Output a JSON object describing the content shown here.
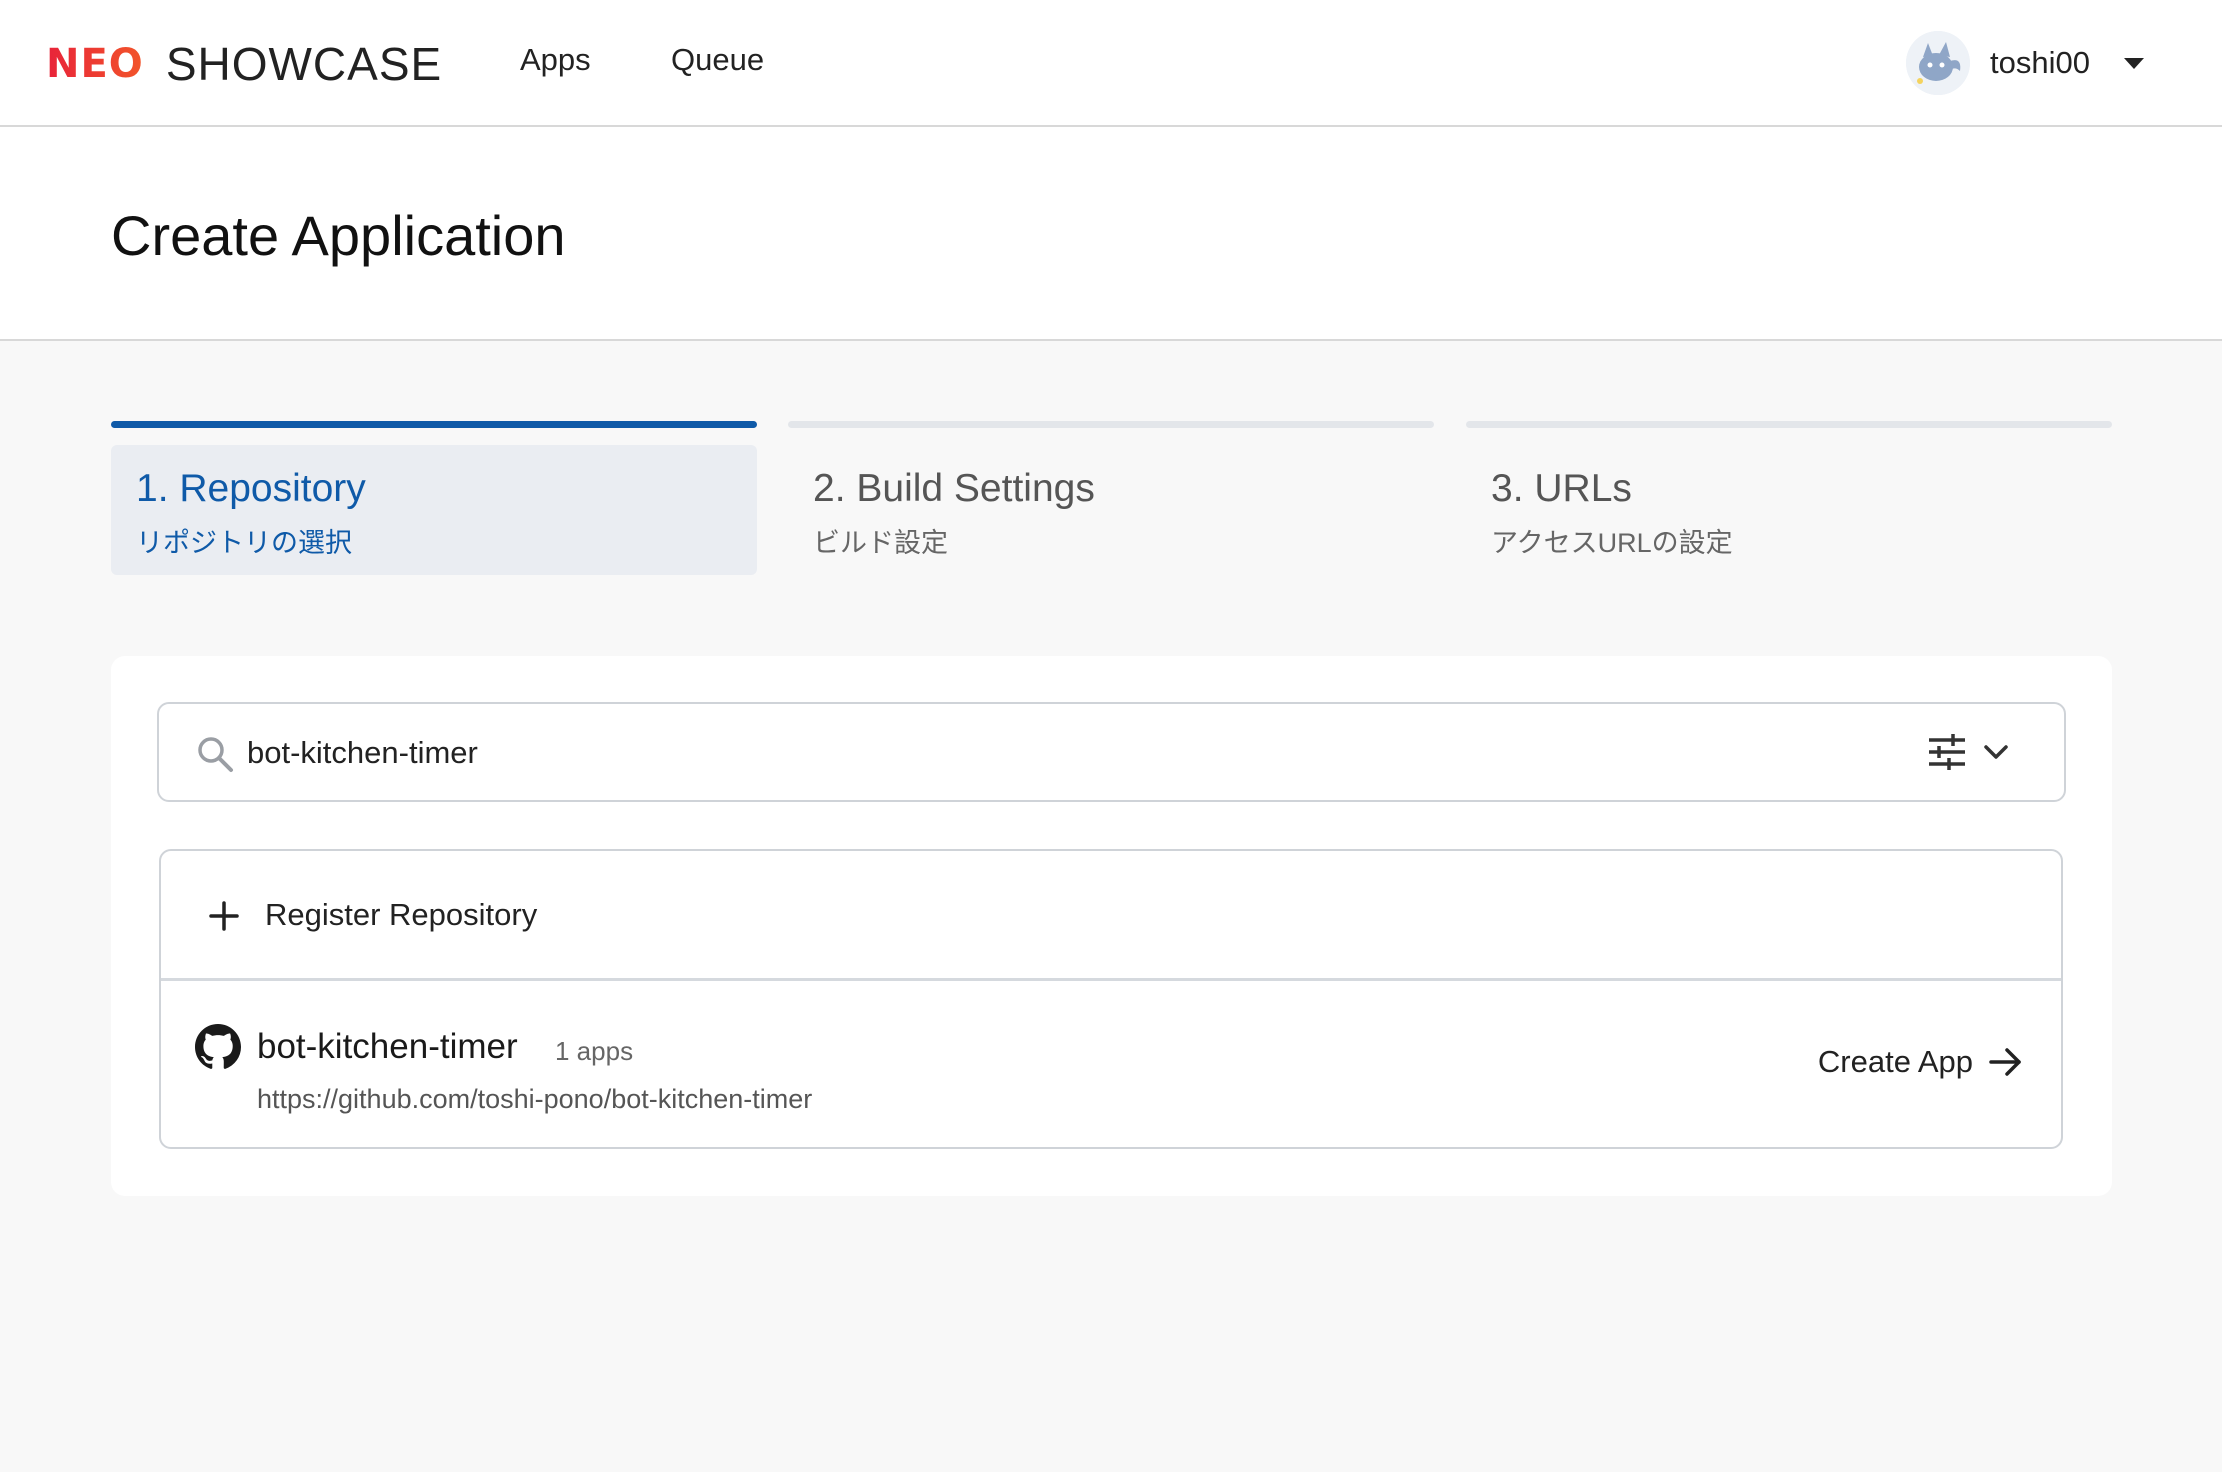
{
  "header": {
    "logo_primary": "NEO",
    "logo_secondary": "SHOWCASE",
    "nav": [
      {
        "label": "Apps"
      },
      {
        "label": "Queue"
      }
    ],
    "user": {
      "name": "toshi00"
    }
  },
  "page": {
    "title": "Create Application"
  },
  "steps": [
    {
      "title": "1. Repository",
      "subtitle": "リポジトリの選択",
      "active": true
    },
    {
      "title": "2. Build Settings",
      "subtitle": "ビルド設定",
      "active": false
    },
    {
      "title": "3. URLs",
      "subtitle": "アクセスURLの設定",
      "active": false
    }
  ],
  "search": {
    "value": "bot-kitchen-timer"
  },
  "list": {
    "register_label": "Register Repository",
    "repositories": [
      {
        "name": "bot-kitchen-timer",
        "apps_count": "1 apps",
        "url": "https://github.com/toshi-pono/bot-kitchen-timer",
        "action_label": "Create App"
      }
    ]
  },
  "colors": {
    "accent": "#0f5aa8",
    "logo": "#e8402f",
    "step_inactive_bar": "#e3e6ea",
    "active_step_bg": "#eaedf2",
    "page_bg": "#f8f8f8"
  },
  "icons": {
    "search": "search-icon",
    "filter": "sliders-icon",
    "filter_toggle": "chevron-down-icon",
    "register": "plus-icon",
    "repo": "github-icon",
    "action": "arrow-right-icon",
    "user_menu": "caret-down-icon"
  }
}
